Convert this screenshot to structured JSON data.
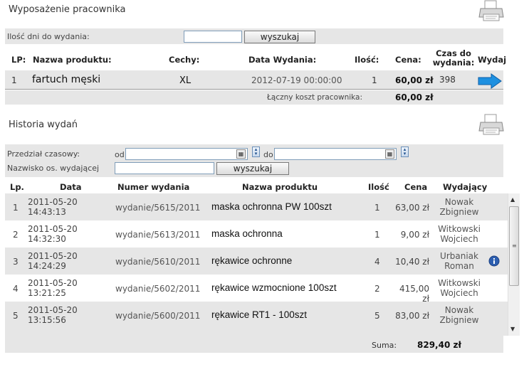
{
  "section1": {
    "title": "Wyposażenie pracownika",
    "days_label": "Ilość dni do wydania:",
    "days_value": "",
    "search_label": "wyszukaj",
    "columns": [
      "LP:",
      "Nazwa produktu:",
      "Cechy:",
      "Data Wydania:",
      "Ilość:",
      "Cena:",
      "Czas do wydania:",
      "Wydaj"
    ],
    "rows": [
      {
        "lp": "1",
        "name": "fartuch męski",
        "features": "XL",
        "date": "2012-07-19 00:00:00",
        "qty": "1",
        "price": "60,00 zł",
        "time": "398"
      }
    ],
    "total_label": "Łączny koszt pracownika:",
    "total_value": "60,00 zł"
  },
  "section2": {
    "title": "Historia wydań",
    "range_label": "Przedział czasowy:",
    "from_label": "od",
    "to_label": "do",
    "from_value": "",
    "to_value": "",
    "issuer_label": "Nazwisko os. wydającej",
    "issuer_value": "",
    "search_label": "wyszukaj",
    "columns": [
      "Lp.",
      "Data",
      "Numer wydania",
      "Nazwa produktu",
      "Ilość",
      "Cena",
      "Wydający"
    ],
    "rows": [
      {
        "lp": "1",
        "date": "2011-05-20",
        "time": "14:43:13",
        "number": "wydanie/5615/2011",
        "product": "maska ochronna PW 100szt",
        "qty": "1",
        "price": "63,00 zł",
        "issuer1": "Nowak",
        "issuer2": "Zbigniew"
      },
      {
        "lp": "2",
        "date": "2011-05-20",
        "time": "14:32:30",
        "number": "wydanie/5613/2011",
        "product": "maska ochronna",
        "qty": "1",
        "price": "9,00 zł",
        "issuer1": "Witkowski",
        "issuer2": "Wojciech"
      },
      {
        "lp": "3",
        "date": "2011-05-20",
        "time": "14:24:29",
        "number": "wydanie/5610/2011",
        "product": "rękawice ochronne",
        "qty": "4",
        "price": "10,40 zł",
        "issuer1": "Urbaniak",
        "issuer2": "Roman"
      },
      {
        "lp": "4",
        "date": "2011-05-20",
        "time": "13:21:25",
        "number": "wydanie/5602/2011",
        "product": "rękawice wzmocnione 100szt",
        "qty": "2",
        "price": "415,00 zł",
        "issuer1": "Witkowski",
        "issuer2": "Wojciech"
      },
      {
        "lp": "5",
        "date": "2011-05-20",
        "time": "13:15:56",
        "number": "wydanie/5600/2011",
        "product": "rękawice RT1 - 100szt",
        "qty": "5",
        "price": "83,00 zł",
        "issuer1": "Nowak",
        "issuer2": "Zbigniew"
      }
    ],
    "sum_label": "Suma:",
    "sum_value": "829,40 zł"
  },
  "colors": {
    "bar": "#e6e6e6",
    "arrow": "#1e90e0",
    "info": "#2d5fb0"
  },
  "icons": {
    "print": "printer-icon",
    "issue": "arrow-right-icon",
    "info": "info-icon",
    "calendar": "calendar-icon"
  }
}
